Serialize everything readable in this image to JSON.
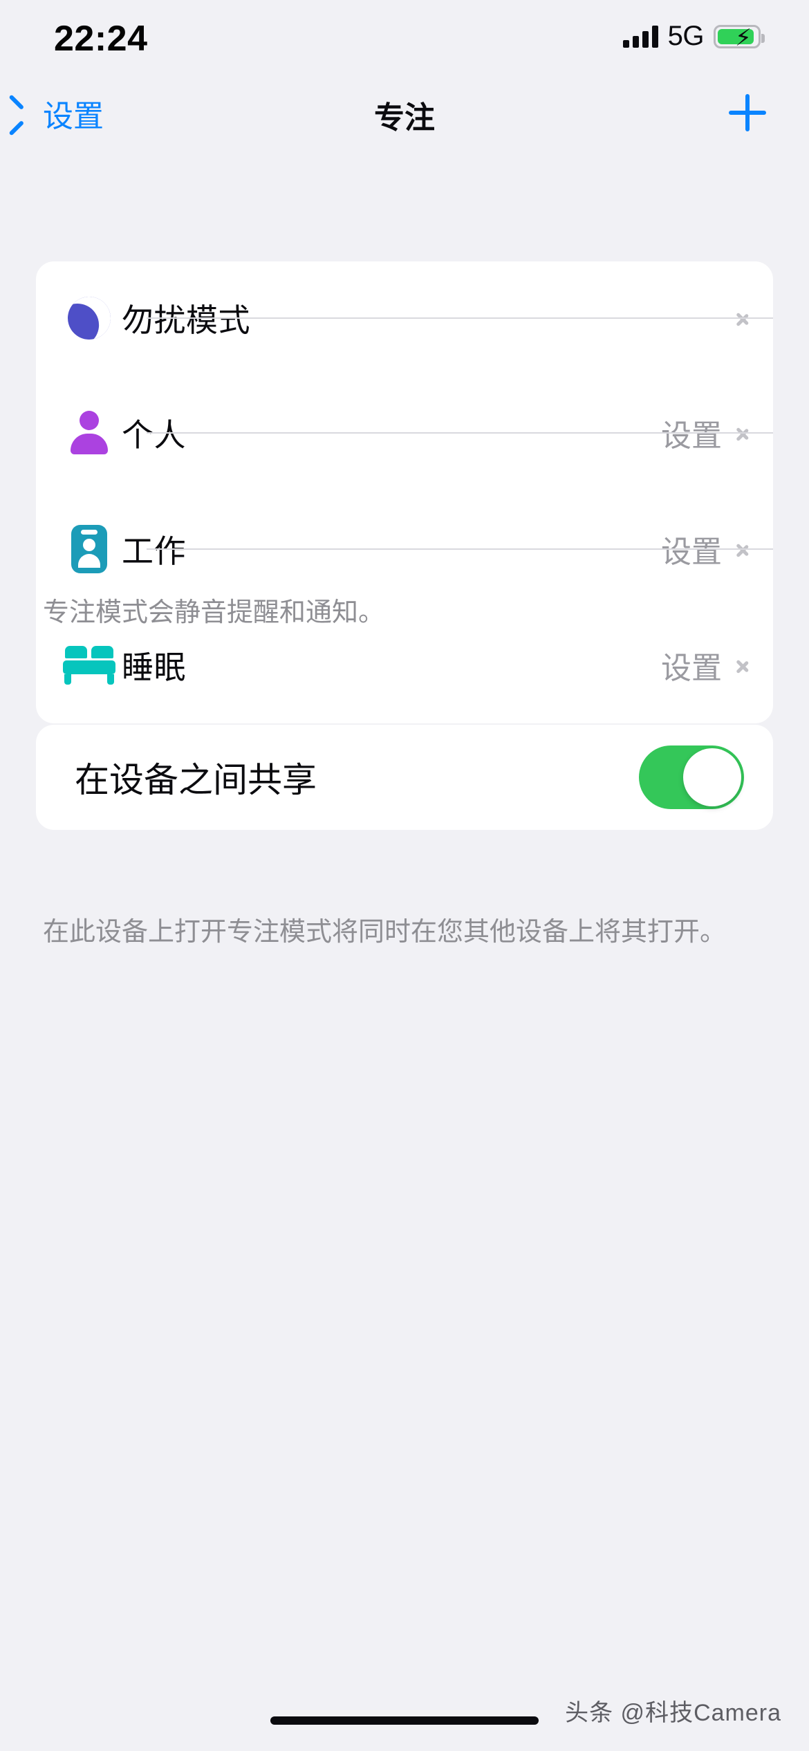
{
  "status_bar": {
    "time": "22:24",
    "network": "5G",
    "signal_icon": "signal-bars-icon",
    "battery_icon": "battery-charging-icon"
  },
  "nav": {
    "back_label": "设置",
    "back_icon": "chevron-left-icon",
    "title": "专注",
    "add_icon": "plus-icon"
  },
  "focus_list": {
    "rows": [
      {
        "icon": "moon-icon",
        "label": "勿扰模式",
        "value": "",
        "chevron": "chevron-right-icon"
      },
      {
        "icon": "person-icon",
        "label": "个人",
        "value": "设置",
        "chevron": "chevron-right-icon"
      },
      {
        "icon": "badge-icon",
        "label": "工作",
        "value": "设置",
        "chevron": "chevron-right-icon"
      },
      {
        "icon": "bed-icon",
        "label": "睡眠",
        "value": "设置",
        "chevron": "chevron-right-icon"
      }
    ],
    "footer": "专注模式会静音提醒和通知。"
  },
  "share_section": {
    "label": "在设备之间共享",
    "toggle_on": true,
    "footer": "在此设备上打开专注模式将同时在您其他设备上将其打开。"
  },
  "watermark": "头条 @科技Camera",
  "colors": {
    "background": "#f1f1f5",
    "card": "#ffffff",
    "accent_blue": "#0a84ff",
    "toggle_green": "#34c759",
    "moon_purple": "#4e4fc7",
    "person_purple": "#ab42e0",
    "badge_teal": "#1c9cb8",
    "bed_teal": "#06c5bd",
    "secondary_text": "#8e8e93"
  }
}
